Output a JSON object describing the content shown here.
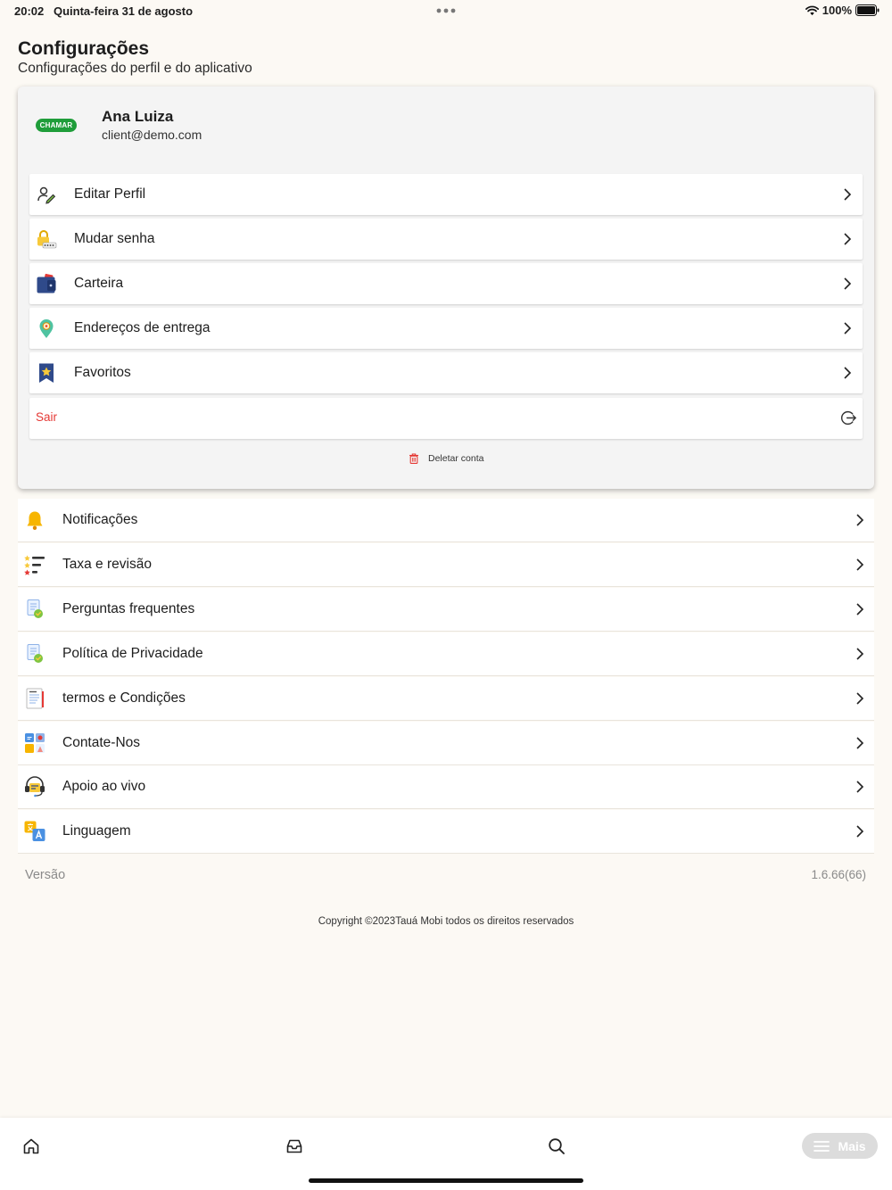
{
  "status_bar": {
    "time": "20:02",
    "date": "Quinta-feira 31 de agosto",
    "battery": "100%"
  },
  "header": {
    "title": "Configurações",
    "subtitle": "Configurações do perfil e do aplicativo"
  },
  "profile": {
    "logo_text": "CHAMAR",
    "name": "Ana Luiza",
    "email": "client@demo.com",
    "menu": [
      {
        "label": "Editar Perfil",
        "icon": "edit-profile-icon"
      },
      {
        "label": "Mudar senha",
        "icon": "password-lock-icon"
      },
      {
        "label": "Carteira",
        "icon": "wallet-icon"
      },
      {
        "label": "Endereços de entrega",
        "icon": "location-pin-icon"
      },
      {
        "label": "Favoritos",
        "icon": "favorites-bookmark-icon"
      }
    ],
    "logout_label": "Sair",
    "delete_label": "Deletar conta"
  },
  "settings": [
    {
      "label": "Notificações",
      "icon": "bell-icon"
    },
    {
      "label": "Taxa e revisão",
      "icon": "rating-icon"
    },
    {
      "label": "Perguntas frequentes",
      "icon": "faq-document-icon"
    },
    {
      "label": "Política de Privacidade",
      "icon": "privacy-document-icon"
    },
    {
      "label": "termos e Condições",
      "icon": "terms-document-icon"
    },
    {
      "label": "Contate-Nos",
      "icon": "contact-icon"
    },
    {
      "label": "Apoio ao vivo",
      "icon": "live-support-icon"
    },
    {
      "label": "Linguagem",
      "icon": "language-icon"
    }
  ],
  "version": {
    "label": "Versão",
    "value": "1.6.66(66)"
  },
  "copyright": "Copyright ©2023Tauá Mobi todos os direitos reservados",
  "bottom_nav": {
    "more_label": "Mais"
  },
  "colors": {
    "background": "#fcf9f4",
    "logout_red": "#e53935",
    "brand_green": "#1f9d3a",
    "more_pill": "#dcdcdc"
  }
}
